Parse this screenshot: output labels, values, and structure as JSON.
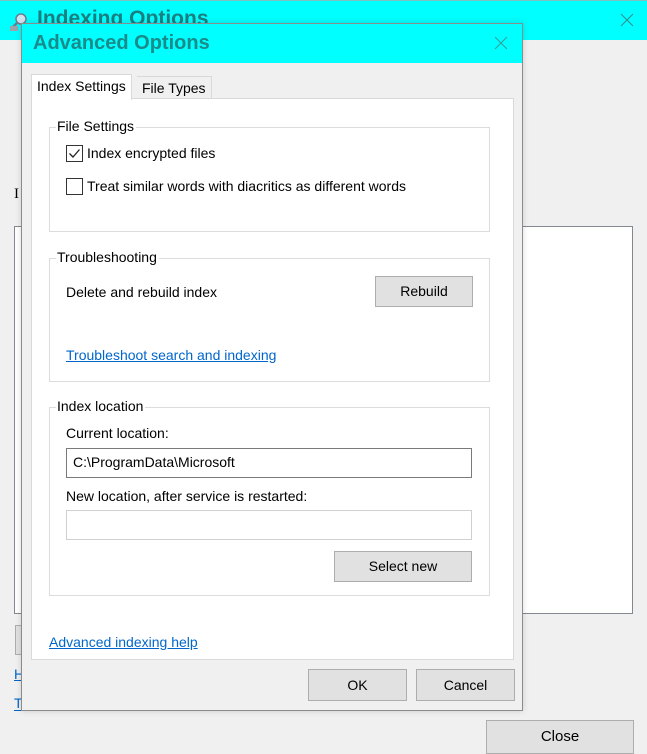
{
  "background_window": {
    "title": "Indexing Options",
    "icon": "indexing-options-icon",
    "partial_label": "I",
    "partial_link_1": "H",
    "partial_link_2": "T",
    "close_button_label": "Close",
    "title_bar_color": "#00ffff"
  },
  "dialog": {
    "title": "Advanced Options",
    "title_bar_color": "#00ffff",
    "title_text_color": "#1a8a8a",
    "tabs": [
      {
        "label": "Index Settings",
        "active": true
      },
      {
        "label": "File Types",
        "active": false
      }
    ],
    "file_settings": {
      "legend": "File Settings",
      "options": [
        {
          "label": "Index encrypted files",
          "checked": true
        },
        {
          "label": "Treat similar words with diacritics as different words",
          "checked": false
        }
      ]
    },
    "troubleshooting": {
      "legend": "Troubleshooting",
      "rebuild_description": "Delete and rebuild index",
      "rebuild_button": "Rebuild",
      "troubleshoot_link": "Troubleshoot search and indexing"
    },
    "index_location": {
      "legend": "Index location",
      "current_label": "Current location:",
      "current_value": "C:\\ProgramData\\Microsoft",
      "new_label": "New location, after service is restarted:",
      "new_value": "",
      "select_new_button": "Select new"
    },
    "help_link": "Advanced indexing help",
    "ok_button": "OK",
    "cancel_button": "Cancel",
    "link_color": "#0066cc"
  }
}
